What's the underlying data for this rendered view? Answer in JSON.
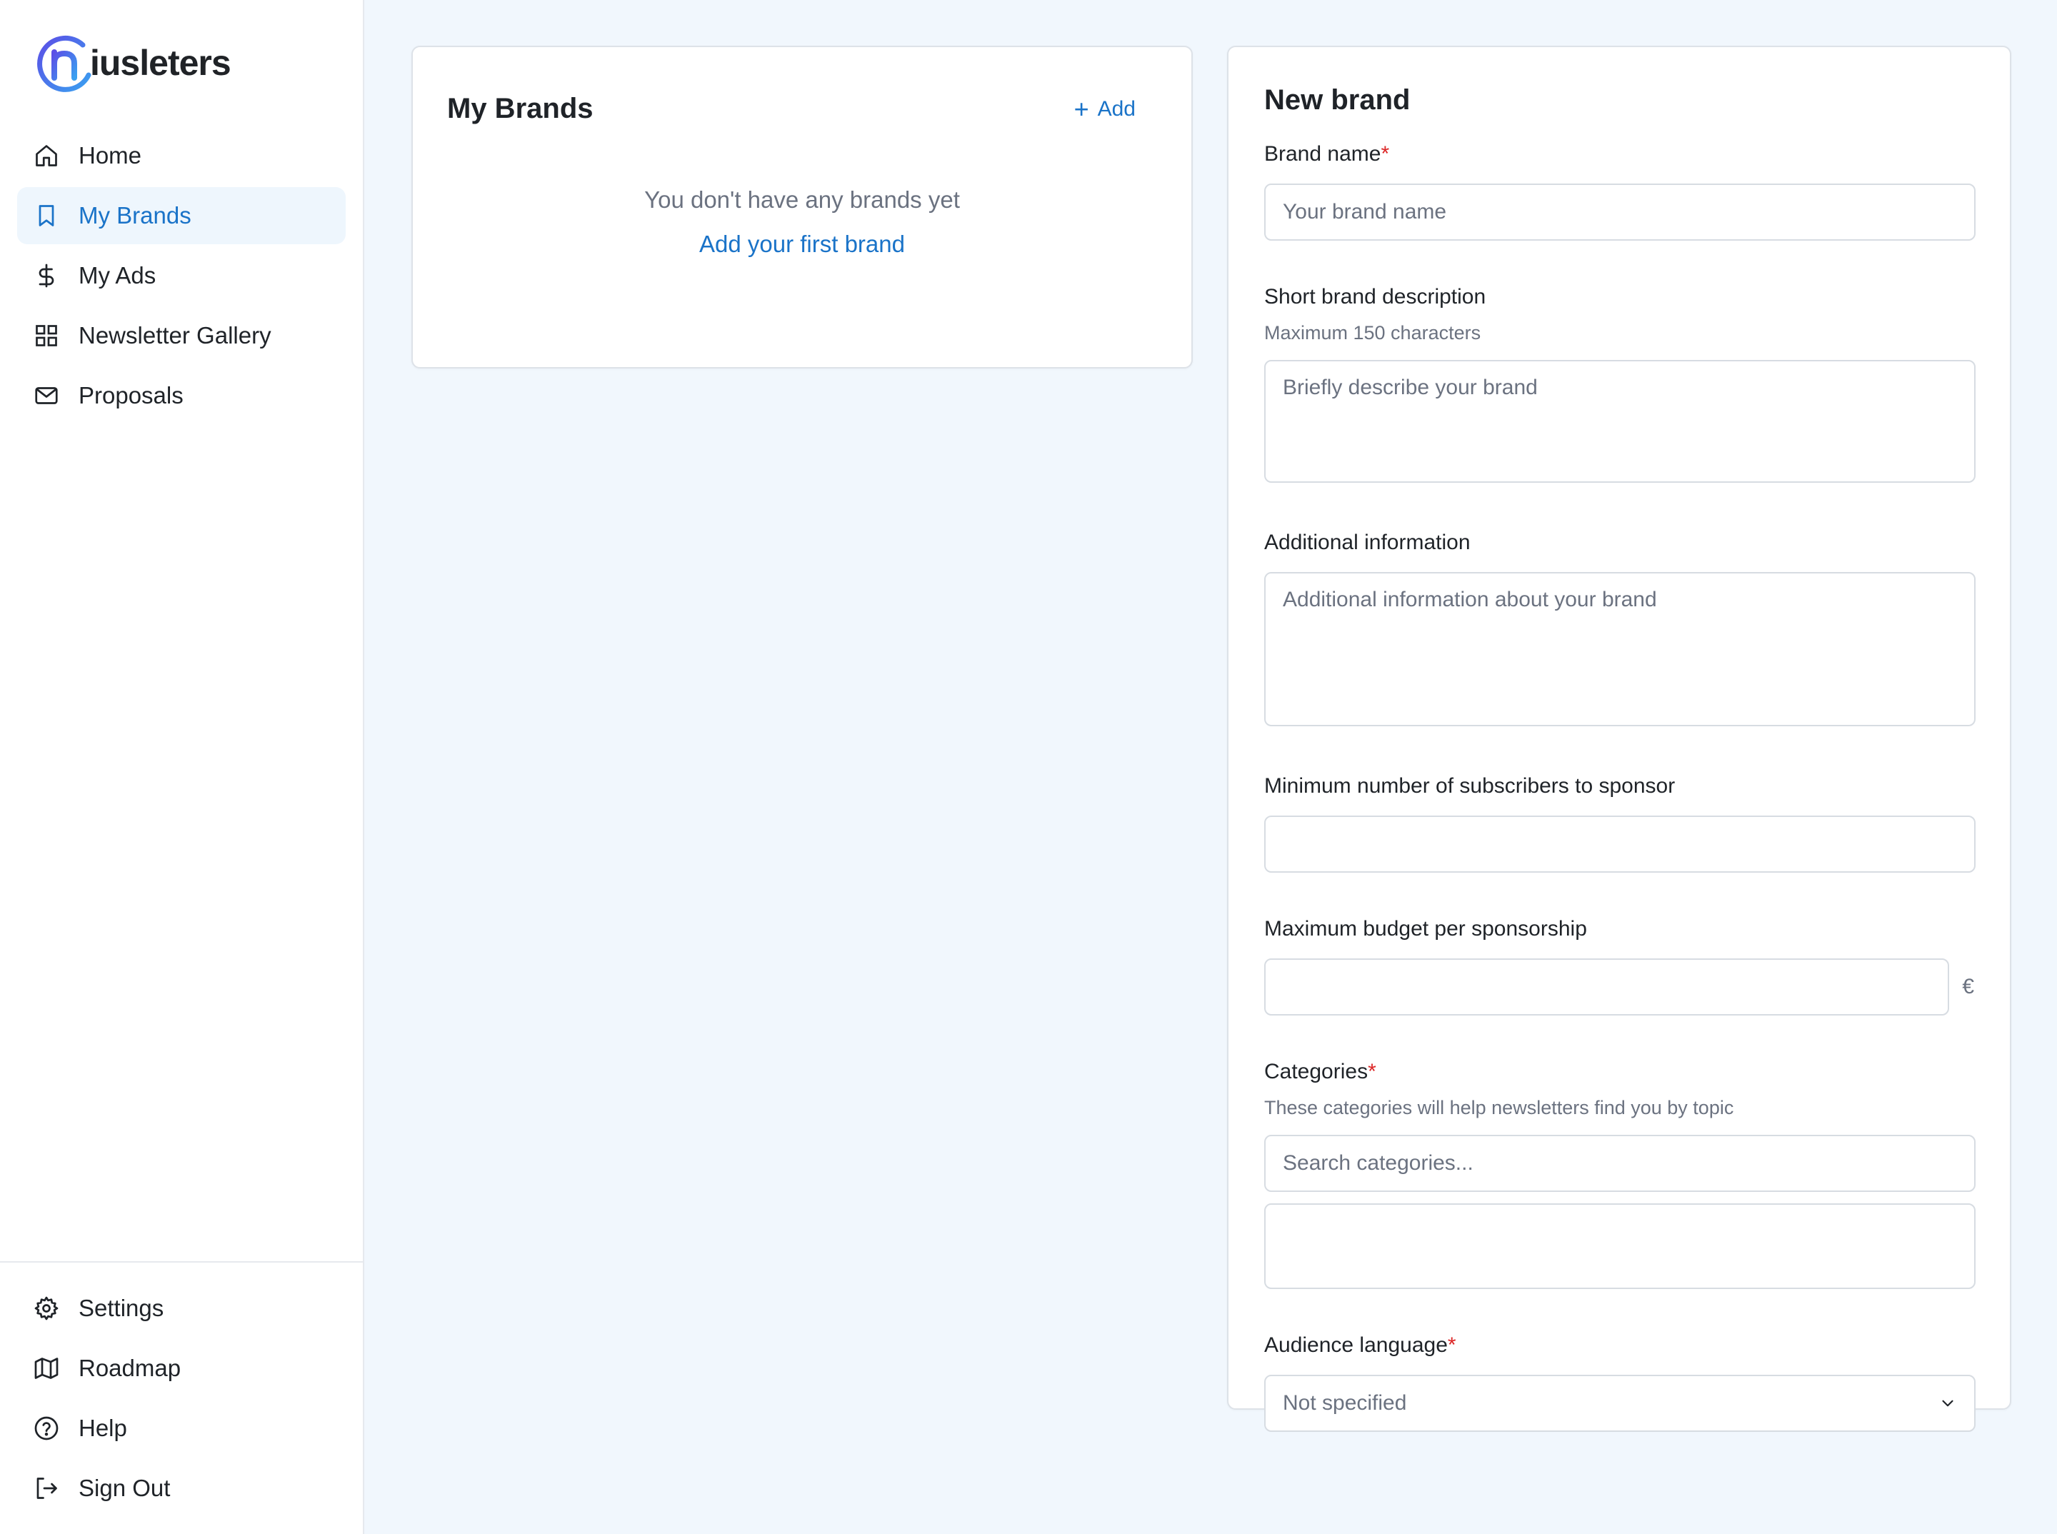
{
  "app": {
    "logo_text": "iusleters"
  },
  "sidebar": {
    "items": [
      {
        "label": "Home",
        "icon": "home-icon"
      },
      {
        "label": "My Brands",
        "icon": "bookmark-icon",
        "active": true
      },
      {
        "label": "My Ads",
        "icon": "dollar-icon"
      },
      {
        "label": "Newsletter Gallery",
        "icon": "grid-icon"
      },
      {
        "label": "Proposals",
        "icon": "mail-icon"
      }
    ],
    "bottom_items": [
      {
        "label": "Settings",
        "icon": "gear-icon"
      },
      {
        "label": "Roadmap",
        "icon": "map-icon"
      },
      {
        "label": "Help",
        "icon": "help-circle-icon"
      },
      {
        "label": "Sign Out",
        "icon": "sign-out-icon"
      }
    ]
  },
  "brands": {
    "title": "My Brands",
    "add_label": "Add",
    "empty_text": "You don't have any brands yet",
    "empty_link": "Add your first brand"
  },
  "form": {
    "title": "New brand",
    "brand_name": {
      "label": "Brand name",
      "required": "*",
      "placeholder": "Your brand name"
    },
    "short_description": {
      "label": "Short brand description",
      "hint": "Maximum 150 characters",
      "placeholder": "Briefly describe your brand"
    },
    "additional_info": {
      "label": "Additional information",
      "placeholder": "Additional information about your brand"
    },
    "min_subscribers": {
      "label": "Minimum number of subscribers to sponsor",
      "value": ""
    },
    "max_budget": {
      "label": "Maximum budget per sponsorship",
      "value": "",
      "currency": "€"
    },
    "categories": {
      "label": "Categories",
      "required": "*",
      "hint": "These categories will help newsletters find you by topic",
      "placeholder": "Search categories..."
    },
    "audience_language": {
      "label": "Audience language",
      "required": "*",
      "selected": "Not specified"
    }
  },
  "colors": {
    "accent": "#1a73c8",
    "required": "#dc2626",
    "background": "#f1f7fd"
  }
}
